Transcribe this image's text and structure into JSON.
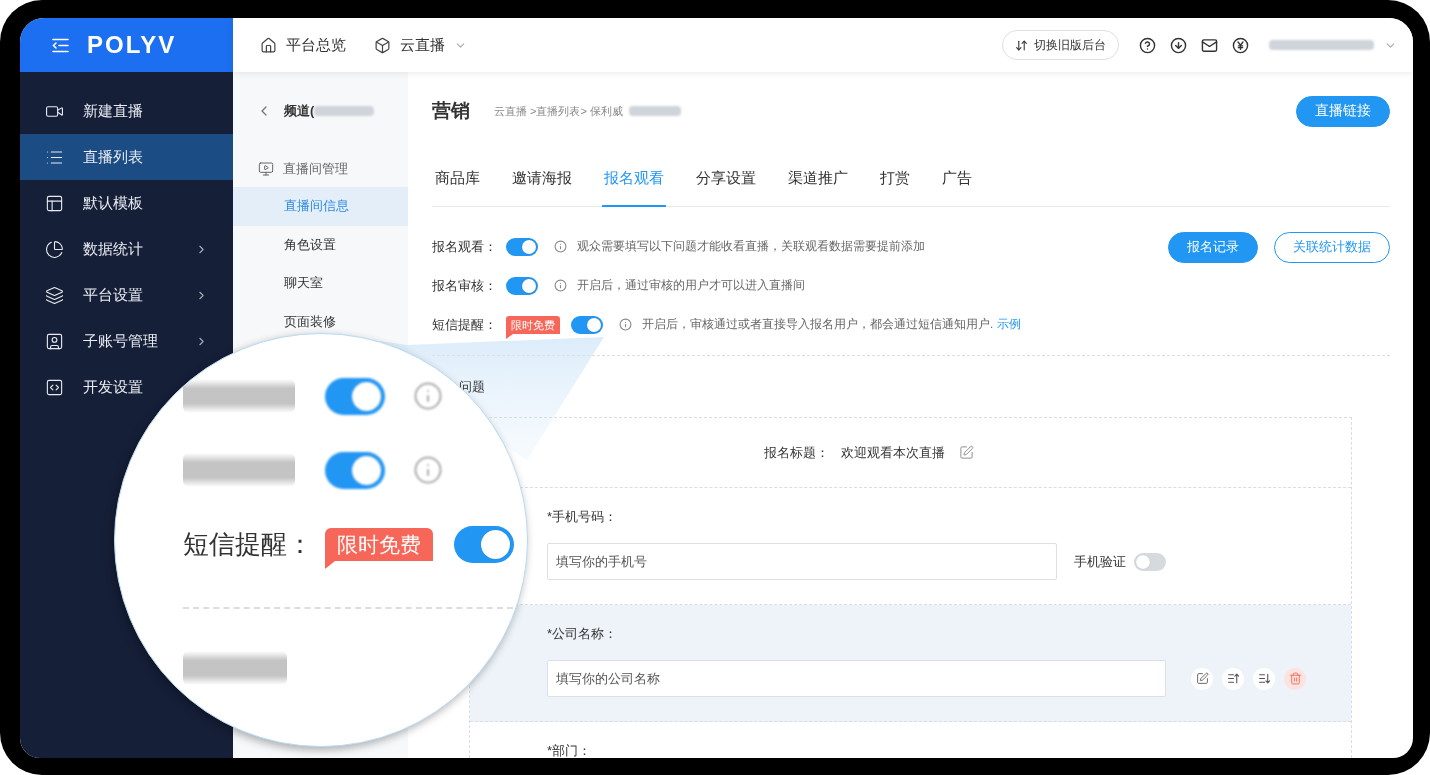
{
  "brand": {
    "logo": "POLYV"
  },
  "top_nav": [
    {
      "label": "平台总览",
      "dropdown": false
    },
    {
      "label": "云直播",
      "dropdown": true
    }
  ],
  "top_actions": {
    "switch_button": "切换旧版后台"
  },
  "sidebar": {
    "items": [
      {
        "label": "新建直播",
        "selected": false,
        "submenu": false
      },
      {
        "label": "直播列表",
        "selected": true,
        "submenu": false
      },
      {
        "label": "默认模板",
        "selected": false,
        "submenu": false
      },
      {
        "label": "数据统计",
        "selected": false,
        "submenu": true
      },
      {
        "label": "平台设置",
        "selected": false,
        "submenu": true
      },
      {
        "label": "子账号管理",
        "selected": false,
        "submenu": true
      },
      {
        "label": "开发设置",
        "selected": false,
        "submenu": false
      }
    ]
  },
  "subnav": {
    "back_label": "频道(",
    "group": "直播间管理",
    "items": [
      {
        "label": "直播间信息",
        "selected": true
      },
      {
        "label": "角色设置",
        "selected": false
      },
      {
        "label": "聊天室",
        "selected": false
      },
      {
        "label": "页面装修",
        "selected": false
      }
    ]
  },
  "header": {
    "title": "营销",
    "breadcrumb": "云直播 >直播列表> 保利威",
    "button": "直播链接"
  },
  "tabs": [
    {
      "label": "商品库",
      "selected": false
    },
    {
      "label": "邀请海报",
      "selected": false
    },
    {
      "label": "报名观看",
      "selected": true
    },
    {
      "label": "分享设置",
      "selected": false
    },
    {
      "label": "渠道推广",
      "selected": false
    },
    {
      "label": "打赏",
      "selected": false
    },
    {
      "label": "广告",
      "selected": false
    }
  ],
  "settings": [
    {
      "label": "报名观看：",
      "on": true,
      "hint": "观众需要填写以下问题才能收看直播，关联观看数据需要提前添加"
    },
    {
      "label": "报名审核：",
      "on": true,
      "hint": "开启后，通过审核的用户才可以进入直播间"
    },
    {
      "label": "短信提醒：",
      "badge": "限时免费",
      "on": true,
      "hint": "开启后，审核通过或者直接导入报名用户，都会通过短信通知用户.",
      "link": "示例"
    }
  ],
  "setting_buttons": [
    {
      "label": "报名记录",
      "kind": "primary"
    },
    {
      "label": "关联统计数据",
      "kind": "outline"
    }
  ],
  "questions": {
    "section_title": "问题",
    "form_title_label": "报名标题：",
    "form_title": "欢迎观看本次直播",
    "fields": [
      {
        "label": "*手机号码：",
        "placeholder": "填写你的手机号",
        "hovered": false,
        "verify": {
          "label": "手机验证",
          "on": false
        }
      },
      {
        "label": "*公司名称：",
        "placeholder": "填写你的公司名称",
        "hovered": true
      },
      {
        "label": "*部门：",
        "hovered": false
      }
    ]
  },
  "magnifier": {
    "rows": [
      {
        "kind": "blurred",
        "on": true
      },
      {
        "kind": "blurred",
        "on": true
      },
      {
        "kind": "clear",
        "label": "短信提醒：",
        "badge": "限时免费",
        "on": true
      }
    ]
  }
}
